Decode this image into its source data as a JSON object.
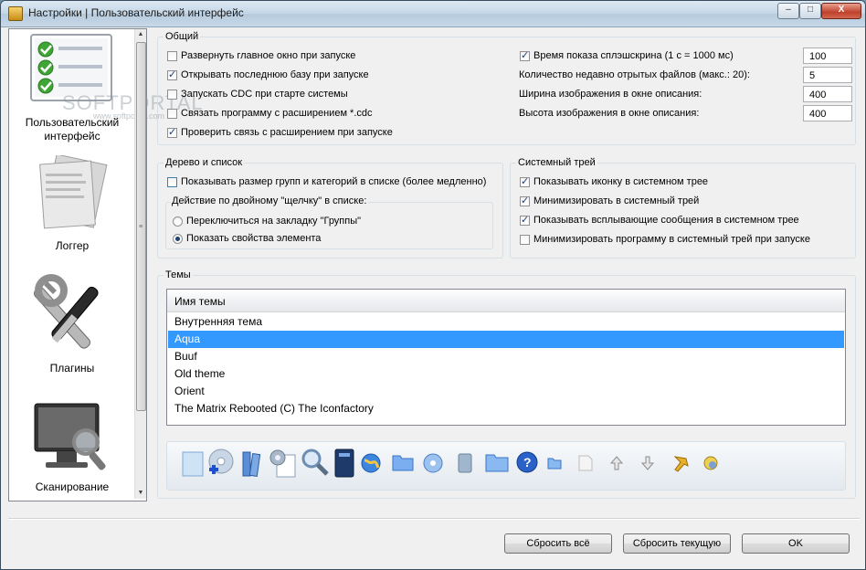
{
  "window": {
    "title": "Настройки | Пользовательский интерфейс"
  },
  "titlebar_buttons": {
    "minimize": "–",
    "maximize": "□",
    "close": "X"
  },
  "watermark": {
    "main": "SOFTPORTAL",
    "sub": "www.softportal.com"
  },
  "sidebar": {
    "items": [
      {
        "label_line1": "Пользовательский",
        "label_line2": "интерфейс",
        "icon": "checklist-icon"
      },
      {
        "label_line1": "Логгер",
        "label_line2": "",
        "icon": "log-document-icon"
      },
      {
        "label_line1": "Плагины",
        "label_line2": "",
        "icon": "tools-icon"
      },
      {
        "label_line1": "Сканирование",
        "label_line2": "",
        "icon": "monitor-magnifier-icon"
      }
    ]
  },
  "general": {
    "legend": "Общий",
    "checkboxes": [
      {
        "label": "Развернуть главное окно при запуске",
        "checked": false
      },
      {
        "label": "Открывать последнюю базу при запуске",
        "checked": true
      },
      {
        "label": "Запускать CDC при старте системы",
        "checked": false
      },
      {
        "label": "Связать программу с расширением *.cdc",
        "checked": false
      },
      {
        "label": "Проверить связь с расширением при запуске",
        "checked": true
      }
    ],
    "right": [
      {
        "label": "Время показа сплэшскрина (1 с = 1000 мс)",
        "value": "100",
        "has_checkbox": true,
        "checked": true
      },
      {
        "label": "Количество недавно отрытых файлов (макс.: 20):",
        "value": "5"
      },
      {
        "label": "Ширина изображения в окне описания:",
        "value": "400"
      },
      {
        "label": "Высота изображения в окне описания:",
        "value": "400"
      }
    ]
  },
  "tree": {
    "legend": "Дерево и список",
    "show_size_label": "Показывать размер групп и категорий в списке (более медленно)",
    "dblclick_legend": "Действие по двойному \"щелчку\" в списке:",
    "radio1": "Переключиться на закладку \"Группы\"",
    "radio2": "Показать свойства элемента"
  },
  "tray": {
    "legend": "Системный трей",
    "checkboxes": [
      {
        "label": "Показывать иконку в системном трее",
        "checked": true
      },
      {
        "label": "Минимизировать в системный трей",
        "checked": true
      },
      {
        "label": "Показывать всплывающие сообщения в системном трее",
        "checked": true
      },
      {
        "label": "Минимизировать программу в системный трей при запуске",
        "checked": false
      }
    ]
  },
  "themes": {
    "legend": "Темы",
    "column_header": "Имя темы",
    "rows": [
      "Внутренняя тема",
      "Aqua",
      "Buuf",
      "Old theme",
      "Orient",
      "The Matrix Rebooted (C) The Iconfactory"
    ],
    "selected_index": 1
  },
  "buttons": {
    "reset_all": "Сбросить всё",
    "reset_current": "Сбросить текущую",
    "ok": "OK"
  },
  "colors": {
    "selection": "#3399ff",
    "accent": "#2a62c9"
  }
}
